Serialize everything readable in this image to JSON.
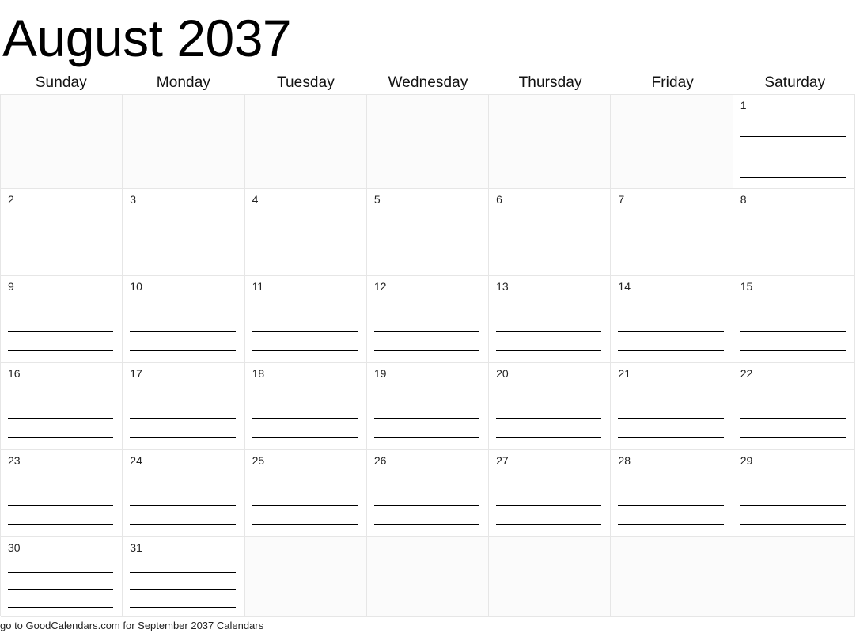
{
  "title": "August 2037",
  "weekdays": [
    "Sunday",
    "Monday",
    "Tuesday",
    "Wednesday",
    "Thursday",
    "Friday",
    "Saturday"
  ],
  "footer": "go to GoodCalendars.com for September 2037 Calendars",
  "colors": {
    "page_background": "#ffffff",
    "grid_line": "#e6e6e6",
    "rule_line": "#000000",
    "empty_cell_background": "#fbfbfb",
    "text": "#000000"
  },
  "layout": {
    "rules_per_cell": 4,
    "columns": 7,
    "rows": 6
  },
  "weeks": [
    [
      {
        "day": "",
        "empty": true
      },
      {
        "day": "",
        "empty": true
      },
      {
        "day": "",
        "empty": true
      },
      {
        "day": "",
        "empty": true
      },
      {
        "day": "",
        "empty": true
      },
      {
        "day": "",
        "empty": true
      },
      {
        "day": "1",
        "empty": false
      }
    ],
    [
      {
        "day": "2",
        "empty": false
      },
      {
        "day": "3",
        "empty": false
      },
      {
        "day": "4",
        "empty": false
      },
      {
        "day": "5",
        "empty": false
      },
      {
        "day": "6",
        "empty": false
      },
      {
        "day": "7",
        "empty": false
      },
      {
        "day": "8",
        "empty": false
      }
    ],
    [
      {
        "day": "9",
        "empty": false
      },
      {
        "day": "10",
        "empty": false
      },
      {
        "day": "11",
        "empty": false
      },
      {
        "day": "12",
        "empty": false
      },
      {
        "day": "13",
        "empty": false
      },
      {
        "day": "14",
        "empty": false
      },
      {
        "day": "15",
        "empty": false
      }
    ],
    [
      {
        "day": "16",
        "empty": false
      },
      {
        "day": "17",
        "empty": false
      },
      {
        "day": "18",
        "empty": false
      },
      {
        "day": "19",
        "empty": false
      },
      {
        "day": "20",
        "empty": false
      },
      {
        "day": "21",
        "empty": false
      },
      {
        "day": "22",
        "empty": false
      }
    ],
    [
      {
        "day": "23",
        "empty": false
      },
      {
        "day": "24",
        "empty": false
      },
      {
        "day": "25",
        "empty": false
      },
      {
        "day": "26",
        "empty": false
      },
      {
        "day": "27",
        "empty": false
      },
      {
        "day": "28",
        "empty": false
      },
      {
        "day": "29",
        "empty": false
      }
    ],
    [
      {
        "day": "30",
        "empty": false
      },
      {
        "day": "31",
        "empty": false
      },
      {
        "day": "",
        "empty": true
      },
      {
        "day": "",
        "empty": true
      },
      {
        "day": "",
        "empty": true
      },
      {
        "day": "",
        "empty": true
      },
      {
        "day": "",
        "empty": true
      }
    ]
  ]
}
